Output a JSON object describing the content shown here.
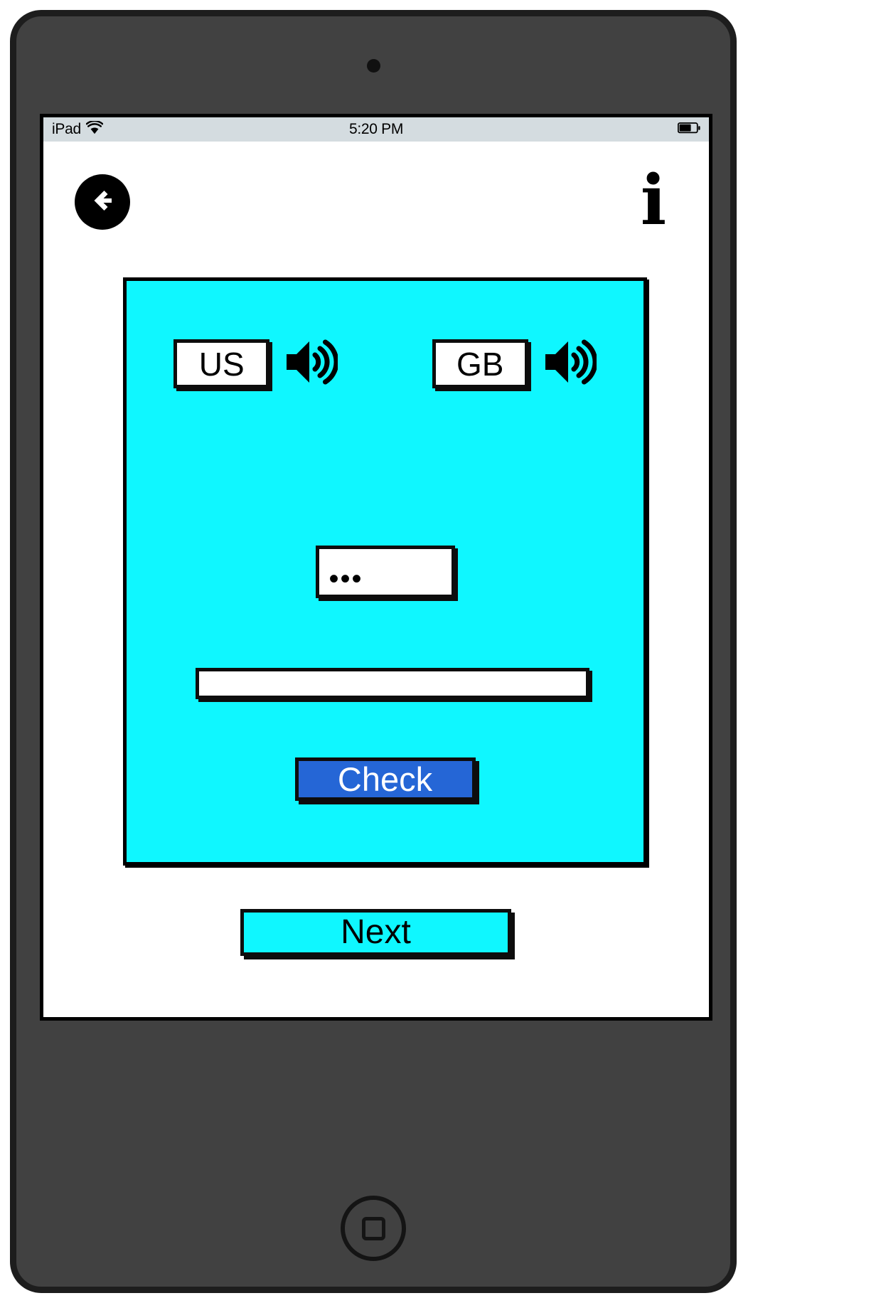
{
  "device": {
    "type": "ipad",
    "camera": "camera-dot",
    "home_button": "home-button"
  },
  "status_bar": {
    "device_label": "iPad",
    "wifi_icon": "wifi-icon",
    "time": "5:20 PM",
    "battery_icon": "battery-icon"
  },
  "nav": {
    "back_icon": "back-arrow-circle-icon",
    "info_label": "i",
    "info_icon": "info-icon"
  },
  "panel": {
    "background_color": "#0ff7ff",
    "languages": [
      {
        "code": "US",
        "speaker_icon": "speaker-volume-icon"
      },
      {
        "code": "GB",
        "speaker_icon": "speaker-volume-icon"
      }
    ],
    "word_display": "•••",
    "answer_input_value": "",
    "answer_input_placeholder": "",
    "check_label": "Check",
    "check_color": "#2566d6"
  },
  "footer": {
    "next_label": "Next",
    "next_color": "#0ff7ff"
  }
}
